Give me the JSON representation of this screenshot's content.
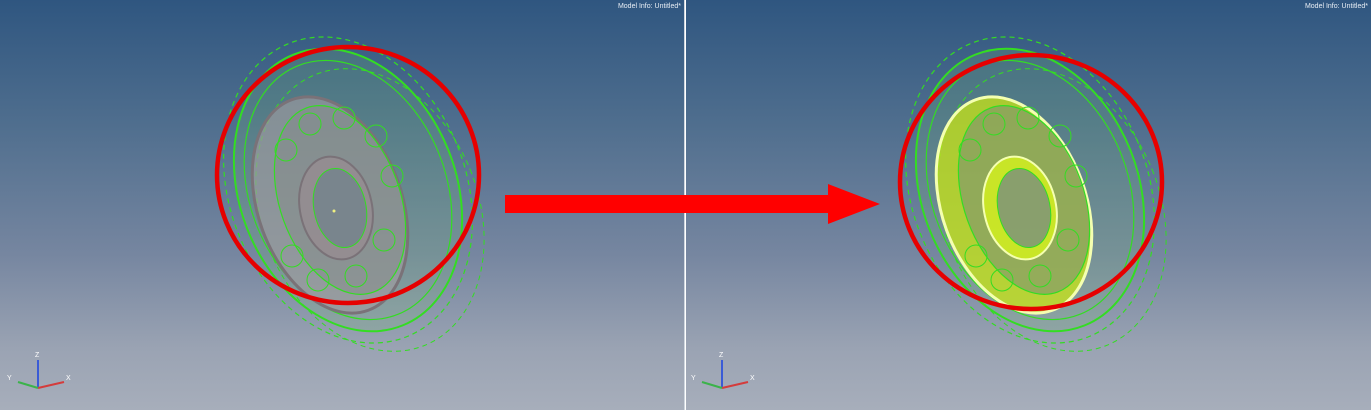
{
  "viewports": [
    {
      "id": "left",
      "model_info": "Model Info: Untitled*",
      "triad_labels": {
        "z": "Z",
        "y": "Y",
        "x": "X"
      },
      "edge_color": "#33dd22",
      "highlight_color": "#d6ff1a"
    },
    {
      "id": "right",
      "model_info": "Model Info: Untitled*",
      "triad_labels": {
        "z": "Z",
        "y": "Y",
        "x": "X"
      },
      "edge_color": "#33dd22",
      "highlight_color": "#d6ff1a"
    }
  ],
  "annotation": {
    "circle_color": "#e60000",
    "arrow_color": "#ff0000"
  }
}
